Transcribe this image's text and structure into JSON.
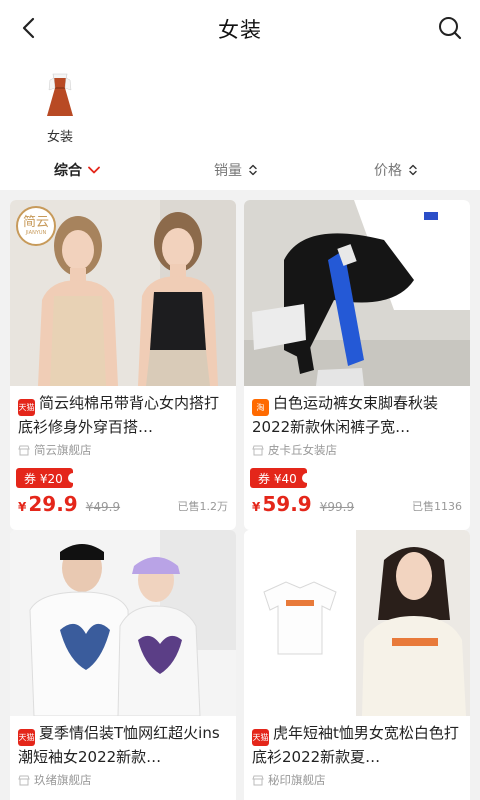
{
  "header": {
    "title": "女装",
    "back_icon": "back-arrow-icon",
    "search_icon": "search-icon"
  },
  "category": {
    "label": "女装"
  },
  "sort": [
    {
      "label": "综合",
      "active": true
    },
    {
      "label": "销量",
      "active": false
    },
    {
      "label": "价格",
      "active": false
    }
  ],
  "products": [
    {
      "store_badge": "天猫",
      "title": "简云纯棉吊带背心女内搭打底衫修身外穿百搭…",
      "shop": "简云旗舰店",
      "brand_logo": {
        "name": "简云",
        "sub": "JIANYUN"
      },
      "coupon": "券 ¥20",
      "price": "29.9",
      "original_price": "¥49.9",
      "sold": "已售1.2万"
    },
    {
      "store_badge": "淘",
      "title": "白色运动裤女束脚春秋装2022新款休闲裤子宽…",
      "shop": "皮卡丘女装店",
      "coupon": "券 ¥40",
      "price": "59.9",
      "original_price": "¥99.9",
      "sold": "已售1136"
    },
    {
      "store_badge": "天猫",
      "title": "夏季情侣装T恤网红超火ins潮短袖女2022新款…",
      "shop": "玖绪旗舰店"
    },
    {
      "store_badge": "天猫",
      "title": "虎年短袖t恤男女宽松白色打底衫2022新款夏…",
      "shop": "秘印旗舰店"
    }
  ],
  "currency_symbol": "¥",
  "colors": {
    "accent": "#e4261a",
    "taobao": "#ff6a00"
  }
}
